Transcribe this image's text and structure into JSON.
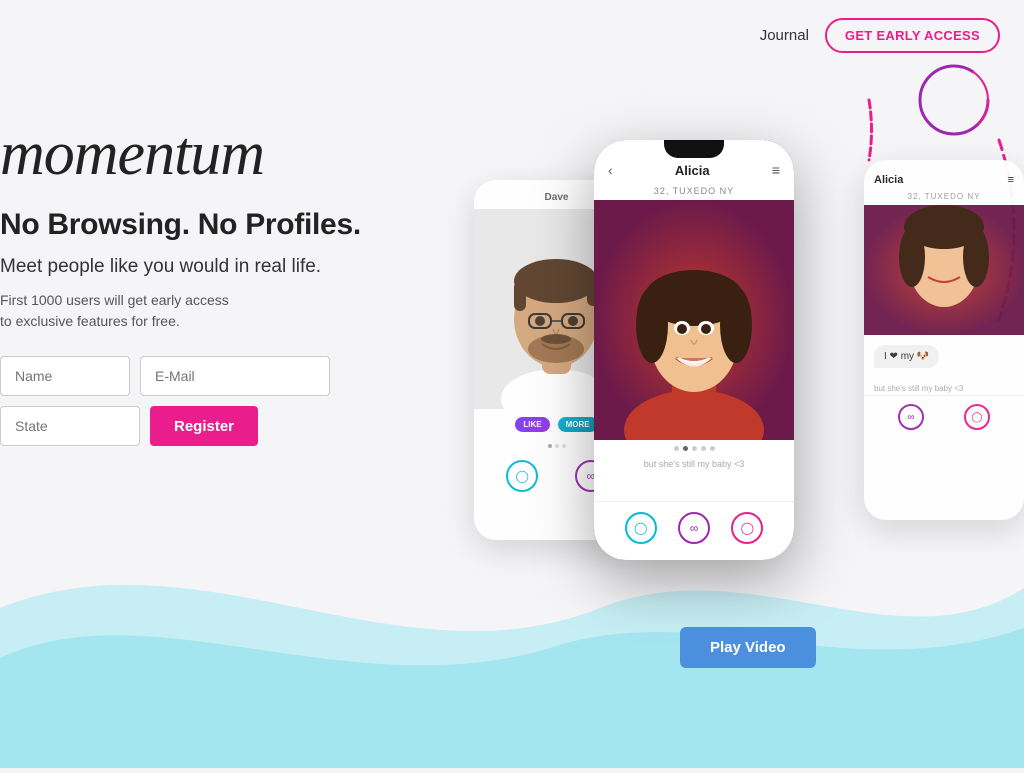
{
  "nav": {
    "journal_label": "Journal",
    "cta_label": "GET EARLY ACCESS"
  },
  "hero": {
    "title": "momentum",
    "subtitle": "No Browsing. No Profiles.",
    "desc": "Meet people like you would in real life.",
    "small_line1": "First 1000 users will get early access",
    "small_line2": "to exclusive features for free.",
    "form": {
      "name_placeholder": "Name",
      "email_placeholder": "E-Mail",
      "state_placeholder": "State",
      "register_label": "Register"
    }
  },
  "phones": {
    "main": {
      "name": "Alicia",
      "location": "32, TUXEDO NY"
    },
    "back_left": {
      "name": "Dave"
    },
    "back_right": {
      "name": "Alicia",
      "location": "32, TUXEDO NY",
      "chat_text": "I ❤ my 🐶"
    }
  },
  "video": {
    "button_label": "Play Video"
  }
}
